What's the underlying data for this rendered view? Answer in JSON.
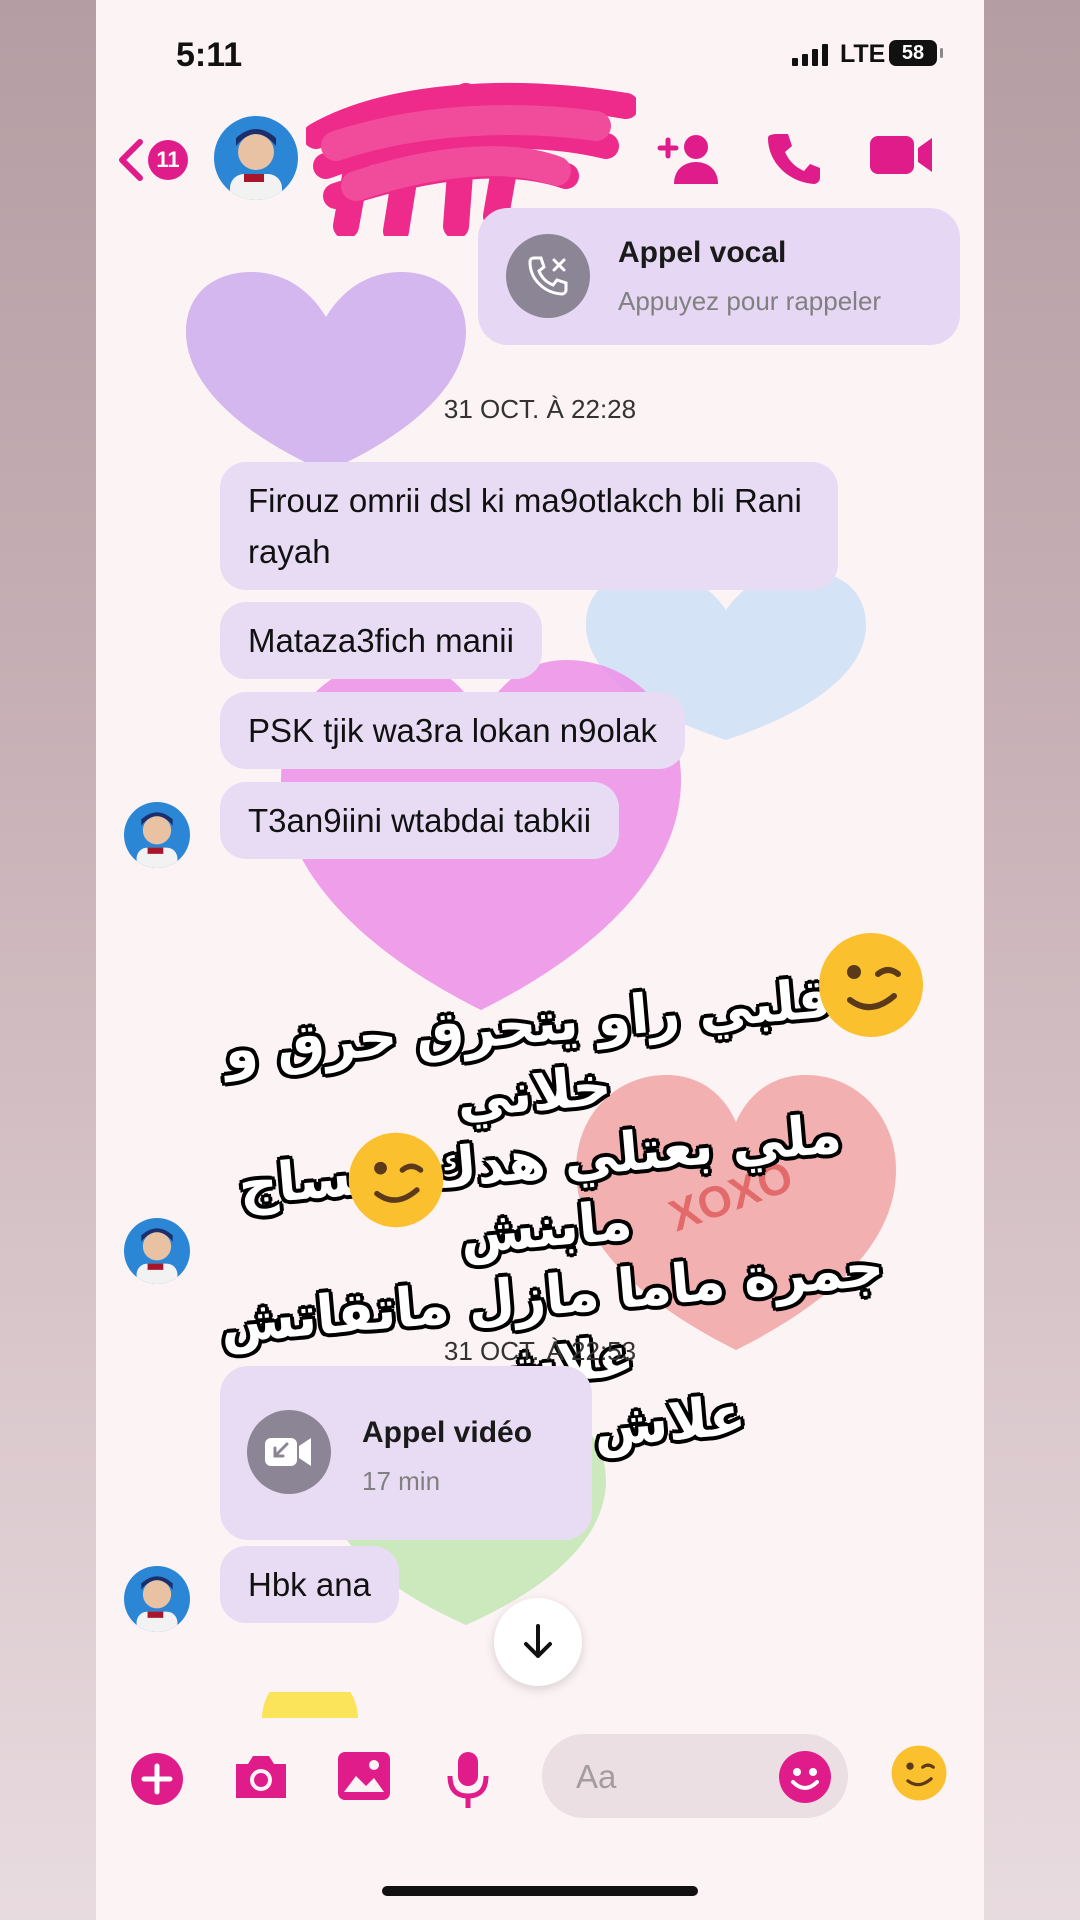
{
  "status_bar": {
    "time": "5:11",
    "network": "LTE",
    "battery": "58"
  },
  "header": {
    "unread_count": "11",
    "icons": [
      "back-chevron-icon",
      "add-person-icon",
      "phone-icon",
      "video-camera-icon"
    ]
  },
  "missed_call": {
    "title": "Appel vocal",
    "subtitle": "Appuyez pour rappeler",
    "icon": "missed-call-icon"
  },
  "timestamps": [
    "31 OCT. À 22:28",
    "31 OCT. À 22:53"
  ],
  "messages_group1": [
    "Firouz omrii dsl ki ma9otlakch bli Rani rayah",
    "Mataza3fich manii",
    "PSK tjik wa3ra lokan n9olak",
    "T3an9iini wtabdai tabkii"
  ],
  "overlay_lines": [
    "قلبي راو يتحرق حرق و خلاني",
    "ملي  بعتلي هدك لمساج  مابنش",
    "جمرة ماما مازل ماتقاتش علاش",
    "علاش"
  ],
  "overlay_emojis": "😭😭💔",
  "sticker_text": "XOXO",
  "video_call": {
    "title": "Appel vidéo",
    "duration": "17 min",
    "icon": "video-call-icon"
  },
  "messages_group2": [
    "Hbk ana"
  ],
  "composer": {
    "placeholder": "Aa",
    "icons": [
      "plus-icon",
      "camera-icon",
      "gallery-icon",
      "microphone-icon",
      "smiley-icon",
      "wink-emoji-icon"
    ]
  },
  "colors": {
    "accent": "#e01c8a",
    "bubble": "#e8dcf5",
    "background": "#fcf3f4"
  }
}
